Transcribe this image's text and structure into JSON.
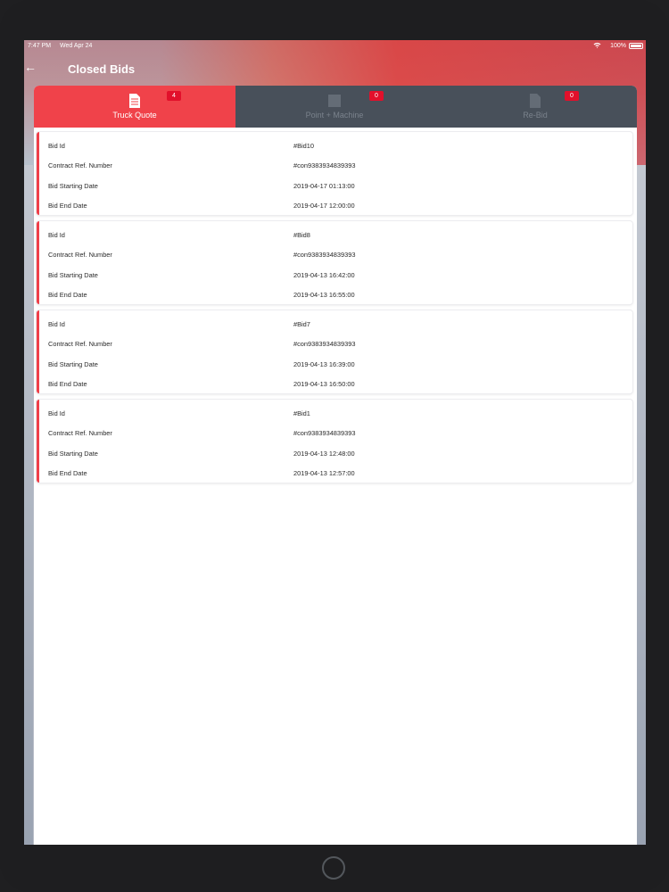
{
  "status_bar": {
    "time": "7:47 PM",
    "date": "Wed Apr 24",
    "battery": "100%"
  },
  "header": {
    "title": "Closed Bids"
  },
  "tabs": [
    {
      "label": "Truck Quote",
      "badge": "4",
      "active": true
    },
    {
      "label": "Point + Machine",
      "badge": "0",
      "active": false
    },
    {
      "label": "Re-Bid",
      "badge": "0",
      "active": false
    }
  ],
  "field_labels": {
    "bid_id": "Bid Id",
    "contract_ref": "Contract Ref. Number",
    "start_date": "Bid Starting Date",
    "end_date": "Bid End Date"
  },
  "bids": [
    {
      "bid_id": "#Bid10",
      "contract_ref": "#con9383934839393",
      "start_date": "2019-04-17 01:13:00",
      "end_date": "2019-04-17 12:00:00"
    },
    {
      "bid_id": "#Bid8",
      "contract_ref": "#con9383934839393",
      "start_date": "2019-04-13 16:42:00",
      "end_date": "2019-04-13 16:55:00"
    },
    {
      "bid_id": "#Bid7",
      "contract_ref": "#con9383934839393",
      "start_date": "2019-04-13 16:39:00",
      "end_date": "2019-04-13 16:50:00"
    },
    {
      "bid_id": "#Bid1",
      "contract_ref": "#con9383934839393",
      "start_date": "2019-04-13 12:48:00",
      "end_date": "2019-04-13 12:57:00"
    }
  ],
  "colors": {
    "accent": "#f0424a",
    "tab_inactive": "#48505a",
    "badge": "#e2102b"
  },
  "icons": {
    "back": "arrow-left-icon",
    "wifi": "wifi-icon",
    "battery": "battery-icon",
    "tab": "document-icon"
  }
}
